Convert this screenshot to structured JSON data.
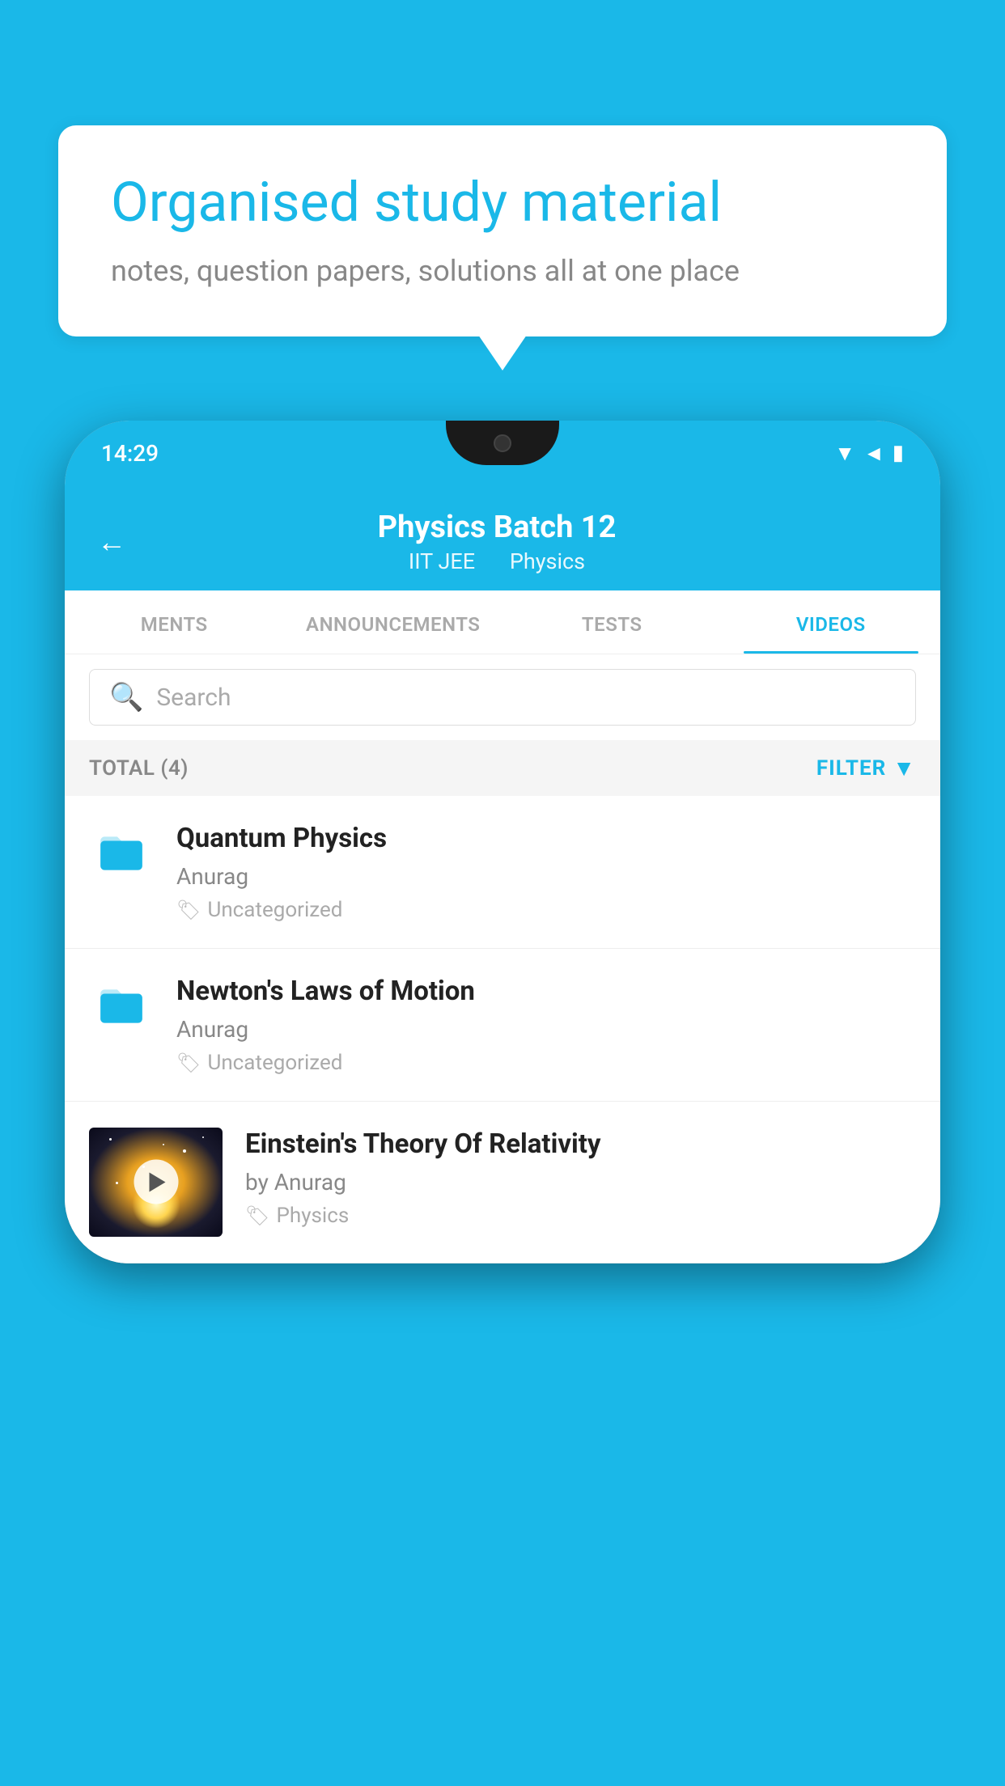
{
  "background_color": "#1ab8e8",
  "speech_bubble": {
    "title": "Organised study material",
    "subtitle": "notes, question papers, solutions all at one place"
  },
  "phone": {
    "status_bar": {
      "time": "14:29",
      "icons": [
        "wifi",
        "signal",
        "battery"
      ]
    },
    "header": {
      "title": "Physics Batch 12",
      "subtitle_parts": [
        "IIT JEE",
        "Physics"
      ],
      "back_label": "←"
    },
    "tabs": [
      {
        "label": "MENTS",
        "active": false
      },
      {
        "label": "ANNOUNCEMENTS",
        "active": false
      },
      {
        "label": "TESTS",
        "active": false
      },
      {
        "label": "VIDEOS",
        "active": true
      }
    ],
    "search": {
      "placeholder": "Search"
    },
    "filter_row": {
      "total_label": "TOTAL (4)",
      "filter_label": "FILTER"
    },
    "videos": [
      {
        "id": 1,
        "title": "Quantum Physics",
        "author": "Anurag",
        "tag": "Uncategorized",
        "type": "folder"
      },
      {
        "id": 2,
        "title": "Newton's Laws of Motion",
        "author": "Anurag",
        "tag": "Uncategorized",
        "type": "folder"
      },
      {
        "id": 3,
        "title": "Einstein's Theory Of Relativity",
        "author": "by Anurag",
        "tag": "Physics",
        "type": "video"
      }
    ]
  }
}
